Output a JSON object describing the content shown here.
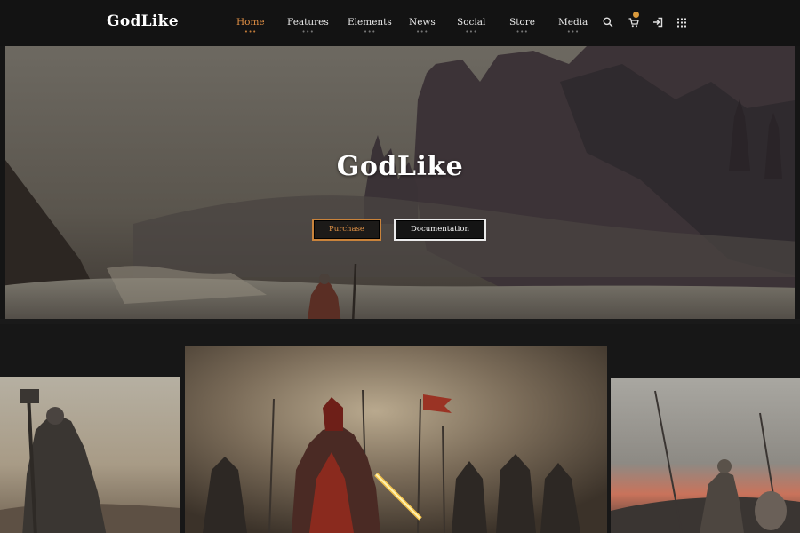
{
  "brand": {
    "logo": "GodLike"
  },
  "nav": {
    "items": [
      {
        "label": "Home",
        "active": true
      },
      {
        "label": "Features",
        "active": false
      },
      {
        "label": "Elements",
        "active": false
      },
      {
        "label": "News",
        "active": false
      },
      {
        "label": "Social",
        "active": false
      },
      {
        "label": "Store",
        "active": false
      },
      {
        "label": "Media",
        "active": false
      }
    ],
    "dots": "•••",
    "icons": [
      "search-icon",
      "cart-icon",
      "sign-in-icon",
      "grid-menu-icon"
    ]
  },
  "hero": {
    "title": "GodLike",
    "purchase_label": "Purchase",
    "docs_label": "Documentation"
  },
  "colors": {
    "accent": "#e29045",
    "nav_bg": "#131313",
    "page_bg": "#171717"
  }
}
